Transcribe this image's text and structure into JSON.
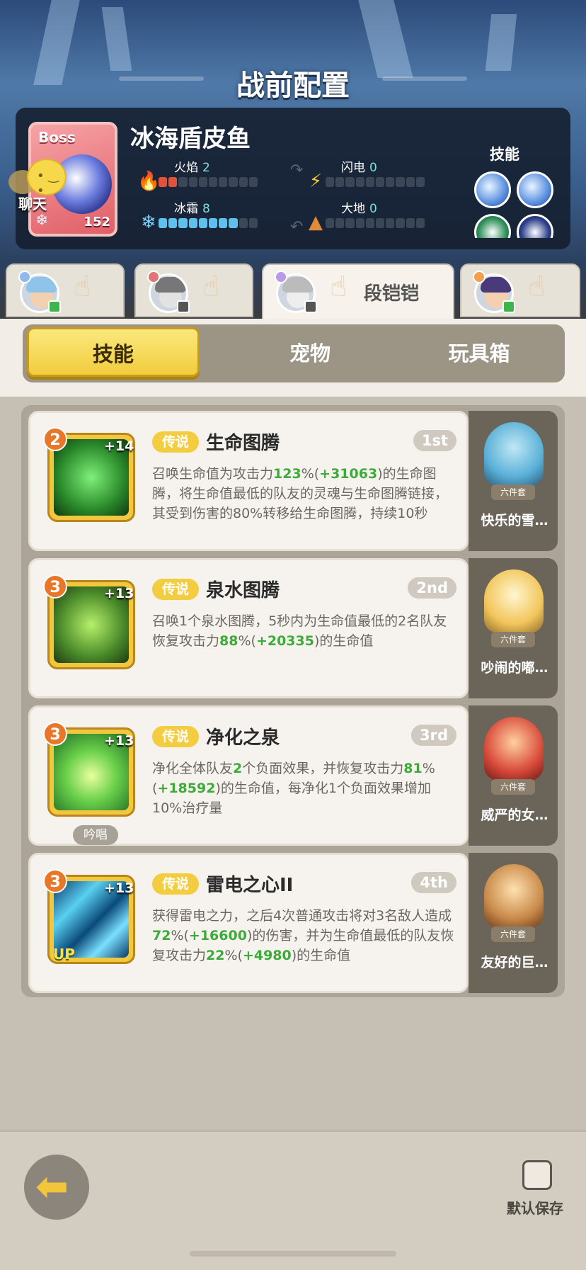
{
  "screen_title": "战前配置",
  "boss": {
    "tag": "Boss",
    "name": "冰海盾皮鱼",
    "level": "152",
    "stats": [
      {
        "label": "火焰",
        "value": "2",
        "filled": 2,
        "type": "fire"
      },
      {
        "label": "闪电",
        "value": "0",
        "filled": 0,
        "type": "lightning"
      },
      {
        "label": "冰霜",
        "value": "8",
        "filled": 8,
        "type": "ice"
      },
      {
        "label": "大地",
        "value": "0",
        "filled": 0,
        "type": "earth"
      }
    ],
    "skills_label": "技能"
  },
  "chat": {
    "label": "聊天"
  },
  "players": [
    {
      "name": "",
      "active": false
    },
    {
      "name": "",
      "active": false
    },
    {
      "name": "段铠铠",
      "active": true
    },
    {
      "name": "",
      "active": false
    }
  ],
  "tabs": [
    {
      "label": "技能",
      "active": true
    },
    {
      "label": "宠物",
      "active": false
    },
    {
      "label": "玩具箱",
      "active": false
    }
  ],
  "skills": [
    {
      "level": "2",
      "plus": "+14",
      "rarity": "传说",
      "title": "生命图腾",
      "rank": "1st",
      "desc": [
        {
          "t": "召唤生命值为攻击力"
        },
        {
          "t": "123",
          "g": true
        },
        {
          "t": "%("
        },
        {
          "t": "+31063",
          "g": true
        },
        {
          "t": ")的生命图腾，将生命值最低的队友的灵魂与生命图腾链接，其受到伤害的80%转移给生命图腾，持续10秒"
        }
      ],
      "pet_name": "快乐的雪…",
      "pet_set": "六件套",
      "chant": ""
    },
    {
      "level": "3",
      "plus": "+13",
      "rarity": "传说",
      "title": "泉水图腾",
      "rank": "2nd",
      "desc": [
        {
          "t": "召唤1个泉水图腾，5秒内为生命值最低的2名队友恢复攻击力"
        },
        {
          "t": "88",
          "g": true
        },
        {
          "t": "%("
        },
        {
          "t": "+20335",
          "g": true
        },
        {
          "t": ")的生命值"
        }
      ],
      "pet_name": "吵闹的嘟…",
      "pet_set": "六件套",
      "chant": ""
    },
    {
      "level": "3",
      "plus": "+13",
      "rarity": "传说",
      "title": "净化之泉",
      "rank": "3rd",
      "desc": [
        {
          "t": "净化全体队友"
        },
        {
          "t": "2",
          "g": true
        },
        {
          "t": "个负面效果，并恢复攻击力"
        },
        {
          "t": "81",
          "g": true
        },
        {
          "t": "%("
        },
        {
          "t": "+18592",
          "g": true
        },
        {
          "t": ")的生命值，每净化1个负面效果增加10%治疗量"
        }
      ],
      "pet_name": "威严的女…",
      "pet_set": "六件套",
      "chant": "吟唱"
    },
    {
      "level": "3",
      "plus": "+13",
      "rarity": "传说",
      "title": "雷电之心II",
      "rank": "4th",
      "desc": [
        {
          "t": "获得雷电之力，之后4次普通攻击将对3名敌人造成"
        },
        {
          "t": "72",
          "g": true
        },
        {
          "t": "%("
        },
        {
          "t": "+16600",
          "g": true
        },
        {
          "t": ")的伤害，并为生命值最低的队友恢复攻击力"
        },
        {
          "t": "22",
          "g": true
        },
        {
          "t": "%("
        },
        {
          "t": "+4980",
          "g": true
        },
        {
          "t": ")的生命值"
        }
      ],
      "pet_name": "友好的巨…",
      "pet_set": "六件套",
      "chant": "",
      "up": "UP"
    }
  ],
  "footer": {
    "save_label": "默认保存"
  },
  "colors": {
    "accent": "#f1cd3d",
    "green": "#3cab3a",
    "fire": "#e0523a",
    "ice": "#5fc0ee"
  }
}
